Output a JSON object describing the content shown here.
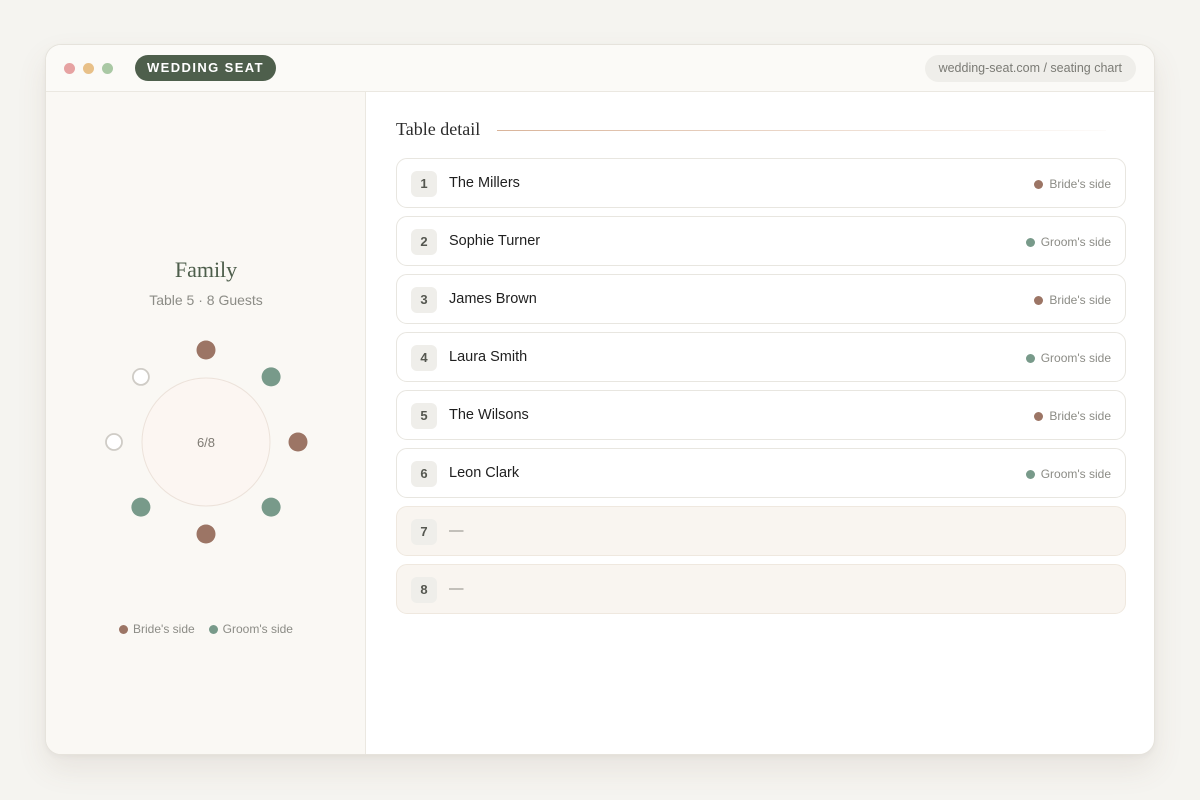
{
  "window": {
    "dot_colors": [
      "#e6a2a2",
      "#e8c088",
      "#a9c8a4"
    ],
    "brand": "WEDDING SEAT",
    "brand_color": "#4e5f4c",
    "url": "wedding-seat.com / seating chart"
  },
  "colors": {
    "bride": "#9c7565",
    "groom": "#789a8a",
    "empty_seat": "#cfccc6"
  },
  "sidebar": {
    "table_name": "Family",
    "table_subtitle": "Table 5 · 8 Guests",
    "occupancy": "6/8",
    "seat_sides": [
      "bride",
      "groom",
      "bride",
      "groom",
      "bride",
      "groom",
      "empty",
      "empty"
    ],
    "legend": [
      {
        "side": "bride",
        "label": "Bride's side"
      },
      {
        "side": "groom",
        "label": "Groom's side"
      }
    ]
  },
  "main": {
    "title": "Table detail",
    "seats": [
      {
        "no": "1",
        "name": "The Millers",
        "side": "bride",
        "side_label": "Bride's side"
      },
      {
        "no": "2",
        "name": "Sophie Turner",
        "side": "groom",
        "side_label": "Groom's side"
      },
      {
        "no": "3",
        "name": "James Brown",
        "side": "bride",
        "side_label": "Bride's side"
      },
      {
        "no": "4",
        "name": "Laura Smith",
        "side": "groom",
        "side_label": "Groom's side"
      },
      {
        "no": "5",
        "name": "The Wilsons",
        "side": "bride",
        "side_label": "Bride's side"
      },
      {
        "no": "6",
        "name": "Leon Clark",
        "side": "groom",
        "side_label": "Groom's side"
      },
      {
        "no": "7",
        "name": "—",
        "side": "empty",
        "side_label": ""
      },
      {
        "no": "8",
        "name": "—",
        "side": "empty",
        "side_label": ""
      }
    ]
  }
}
